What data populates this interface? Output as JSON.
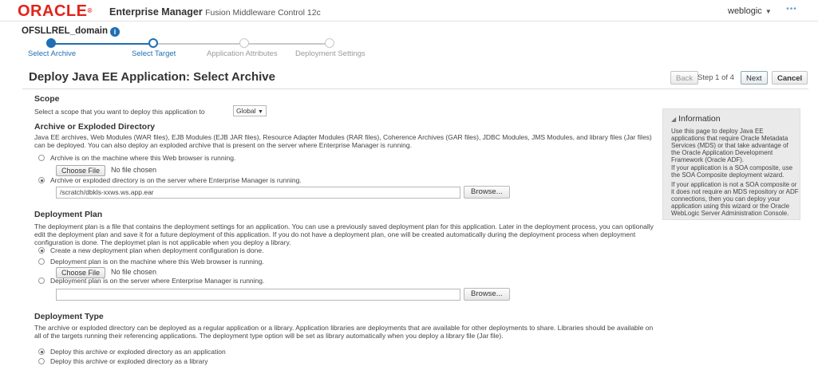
{
  "header": {
    "logo": "ORACLE",
    "reg": "®",
    "product": "Enterprise Manager",
    "product_sub": "Fusion Middleware Control 12c",
    "user": "weblogic",
    "more": "•••"
  },
  "domain": {
    "name": "OFSLLREL_domain",
    "info_icon_text": "i"
  },
  "train": {
    "steps": [
      {
        "label": "Select Archive",
        "state": "visited"
      },
      {
        "label": "Select Target",
        "state": "current"
      },
      {
        "label": "Application Attributes",
        "state": "disabled"
      },
      {
        "label": "Deployment Settings",
        "state": "disabled"
      }
    ],
    "colors": {
      "active": "#1f6fb5",
      "inactive": "#c9c9c9"
    }
  },
  "titlebar": {
    "title": "Deploy Java EE Application: Select Archive",
    "back": "Back",
    "step": "Step 1 of 4",
    "next": "Next",
    "cancel": "Cancel"
  },
  "scope": {
    "heading": "Scope",
    "prompt": "Select a scope that you want to deploy this application to",
    "value": "Global"
  },
  "archive": {
    "heading": "Archive or Exploded Directory",
    "desc": "Java EE archives, Web Modules (WAR files), EJB Modules (EJB JAR files), Resource Adapter Modules (RAR files), Coherence Archives (GAR files), JDBC Modules, JMS Modules, and library files (Jar files) can be deployed. You can also deploy an exploded archive that is present on the server where Enterprise Manager is running.",
    "opt1": "Archive is on the machine where this Web browser is running.",
    "choose_file": "Choose File",
    "no_file": "No file chosen",
    "opt2": "Archive or exploded directory is on the server where Enterprise Manager is running.",
    "path": "/scratch/dbkls-xxws.ws.app.ear",
    "browse": "Browse..."
  },
  "plan": {
    "heading": "Deployment Plan",
    "desc": "The deployment plan is a file that contains the deployment settings for an application. You can use a previously saved deployment plan for this application. Later in the deployment process, you can optionally edit the deployment plan and save it for a future deployment of this application. If you do not have a deployment plan, one will be created automatically during the deployment process when deployment configuration is done. The deploymet plan is not applicable when you deploy a library.",
    "opt1": "Create a new deployment plan when deployment configuration is done.",
    "opt2": "Deployment plan is on the machine where this Web browser is running.",
    "choose_file": "Choose File",
    "no_file": "No file chosen",
    "opt3": "Deployment plan is on the server where Enterprise Manager is running.",
    "path": "",
    "browse": "Browse..."
  },
  "dtype": {
    "heading": "Deployment Type",
    "desc": "The archive or exploded directory can be deployed as a regular application or a library. Application libraries are deployments that are available for other deployments to share. Libraries should be available on all of the targets running their referencing applications. The deployment type option will be set as library automatically when you deploy a library file (Jar file).",
    "opt1": "Deploy this archive or exploded directory as an application",
    "opt2": "Deploy this archive or exploded directory as a library"
  },
  "info": {
    "title": "Information",
    "p1": "Use this page to deploy Java EE applications that require Oracle Metadata Services (MDS) or that take advantage of the Oracle Application Development Framework (Oracle ADF).",
    "p2": "If your application is a SOA composite, use the SOA Composite deployment wizard.",
    "p3": "If your application is not a SOA composite or it does not require an MDS repository or ADF connections, then you can deploy your application using this wizard or the Oracle WebLogic Server Administration Console."
  }
}
